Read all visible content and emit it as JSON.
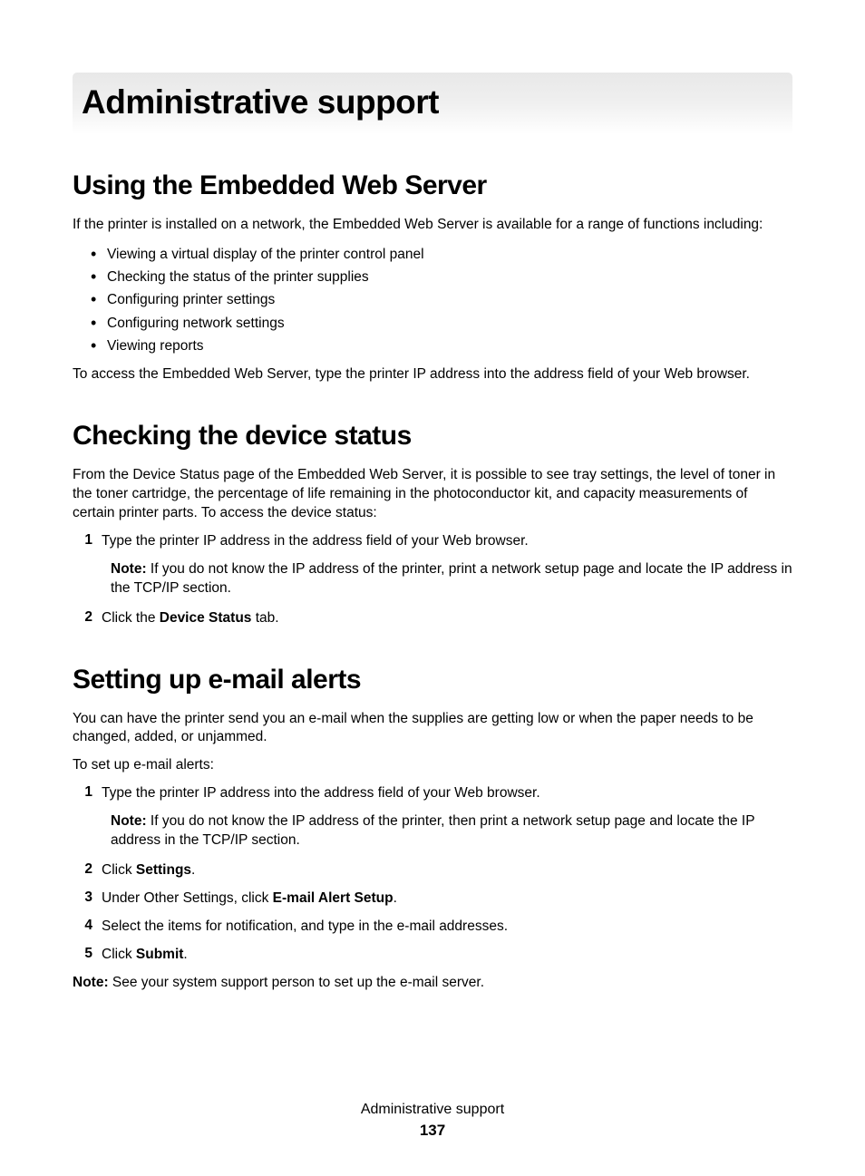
{
  "pageTitle": "Administrative support",
  "section1": {
    "heading": "Using the Embedded Web Server",
    "intro": "If the printer is installed on a network, the Embedded Web Server is available for a range of functions including:",
    "bullets": [
      "Viewing a virtual display of the printer control panel",
      "Checking the status of the printer supplies",
      "Configuring printer settings",
      "Configuring network settings",
      "Viewing reports"
    ],
    "outro": "To access the Embedded Web Server, type the printer IP address into the address field of your Web browser."
  },
  "section2": {
    "heading": "Checking the device status",
    "intro": "From the Device Status page of the Embedded Web Server, it is possible to see tray settings, the level of toner in the toner cartridge, the percentage of life remaining in the photoconductor kit, and capacity measurements of certain printer parts. To access the device status:",
    "step1": {
      "num": "1",
      "text": "Type the printer IP address in the address field of your Web browser.",
      "noteLabel": "Note:",
      "noteText": " If you do not know the IP address of the printer, print a network setup page and locate the IP address in the TCP/IP section."
    },
    "step2": {
      "num": "2",
      "pre": "Click the ",
      "bold": "Device Status",
      "post": " tab."
    }
  },
  "section3": {
    "heading": "Setting up e-mail alerts",
    "intro": "You can have the printer send you an e-mail when the supplies are getting low or when the paper needs to be changed, added, or unjammed.",
    "intro2": "To set up e-mail alerts:",
    "step1": {
      "num": "1",
      "text": "Type the printer IP address into the address field of your Web browser.",
      "noteLabel": "Note:",
      "noteText": " If you do not know the IP address of the printer, then print a network setup page and locate the IP address in the TCP/IP section."
    },
    "step2": {
      "num": "2",
      "pre": "Click ",
      "bold": "Settings",
      "post": "."
    },
    "step3": {
      "num": "3",
      "pre": "Under Other Settings, click ",
      "bold": "E-mail Alert Setup",
      "post": "."
    },
    "step4": {
      "num": "4",
      "text": "Select the items for notification, and type in the e-mail addresses."
    },
    "step5": {
      "num": "5",
      "pre": "Click ",
      "bold": "Submit",
      "post": "."
    },
    "finalNoteLabel": "Note:",
    "finalNoteText": " See your system support person to set up the e-mail server."
  },
  "footer": {
    "title": "Administrative support",
    "page": "137"
  }
}
